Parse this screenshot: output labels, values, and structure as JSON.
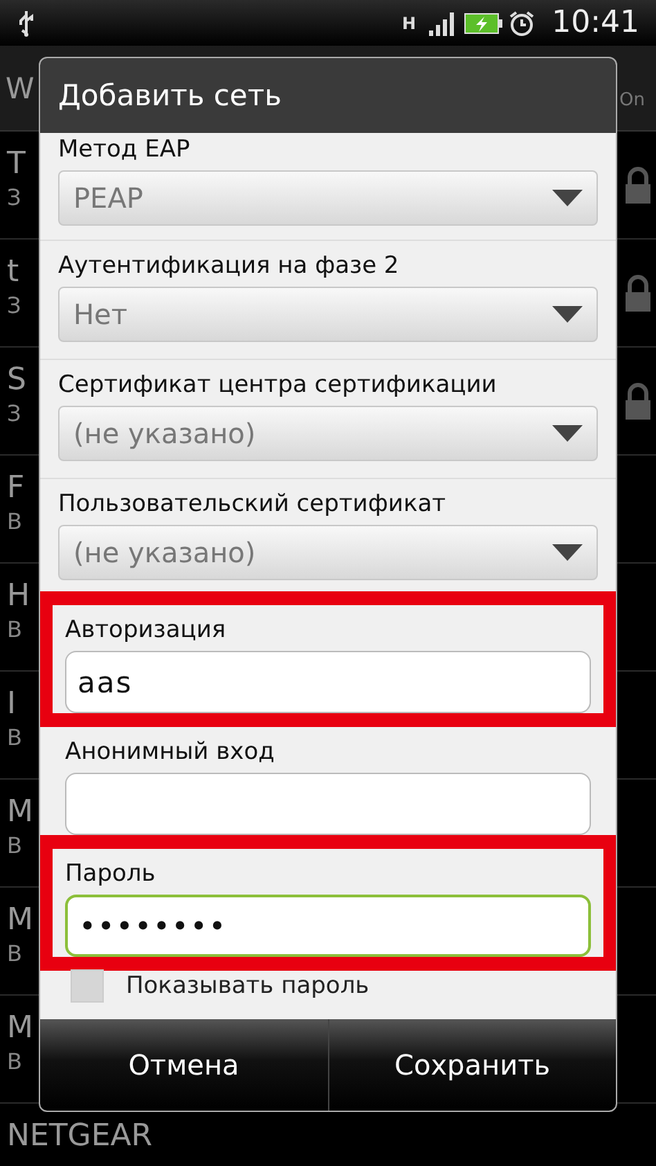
{
  "status_bar": {
    "network": "H",
    "time": "10:41"
  },
  "background": {
    "header": {
      "title": "W",
      "toggle": "On"
    },
    "rows": [
      {
        "title": "T",
        "subtitle": "З",
        "locked": true
      },
      {
        "title": "t",
        "subtitle": "З",
        "locked": true
      },
      {
        "title": "S",
        "subtitle": "З",
        "locked": true
      },
      {
        "title": "F",
        "subtitle": "В",
        "locked": false
      },
      {
        "title": "H",
        "subtitle": "В",
        "locked": false
      },
      {
        "title": "I",
        "subtitle": "В",
        "locked": false
      },
      {
        "title": "M",
        "subtitle": "В",
        "locked": false
      },
      {
        "title": "M",
        "subtitle": "В",
        "locked": false
      },
      {
        "title": "M",
        "subtitle": "В",
        "locked": false
      },
      {
        "title": "NETGEAR",
        "subtitle": "",
        "locked": false
      }
    ]
  },
  "dialog": {
    "title": "Добавить сеть",
    "fields": [
      {
        "kind": "spinner",
        "label": "Метод EAP",
        "value": "PEAP",
        "highlighted": false
      },
      {
        "kind": "spinner",
        "label": "Аутентификация на фазе 2",
        "value": "Нет",
        "highlighted": false
      },
      {
        "kind": "spinner",
        "label": "Сертификат центра сертификации",
        "value": "(не указано)",
        "highlighted": false
      },
      {
        "kind": "spinner",
        "label": "Пользовательский сертификат",
        "value": "(не указано)",
        "highlighted": false
      },
      {
        "kind": "text",
        "label": "Авторизация",
        "value": "aas",
        "highlighted": true,
        "focused": false
      },
      {
        "kind": "text",
        "label": "Анонимный вход",
        "highlighted": false,
        "focused": false
      },
      {
        "kind": "text",
        "label": "Пароль",
        "value": "••••••••",
        "highlighted": true,
        "focused": true
      },
      {
        "kind": "checkbox",
        "label": "Показывать пароль",
        "checked": false
      }
    ],
    "buttons": [
      "Отмена",
      "Сохранить"
    ]
  }
}
